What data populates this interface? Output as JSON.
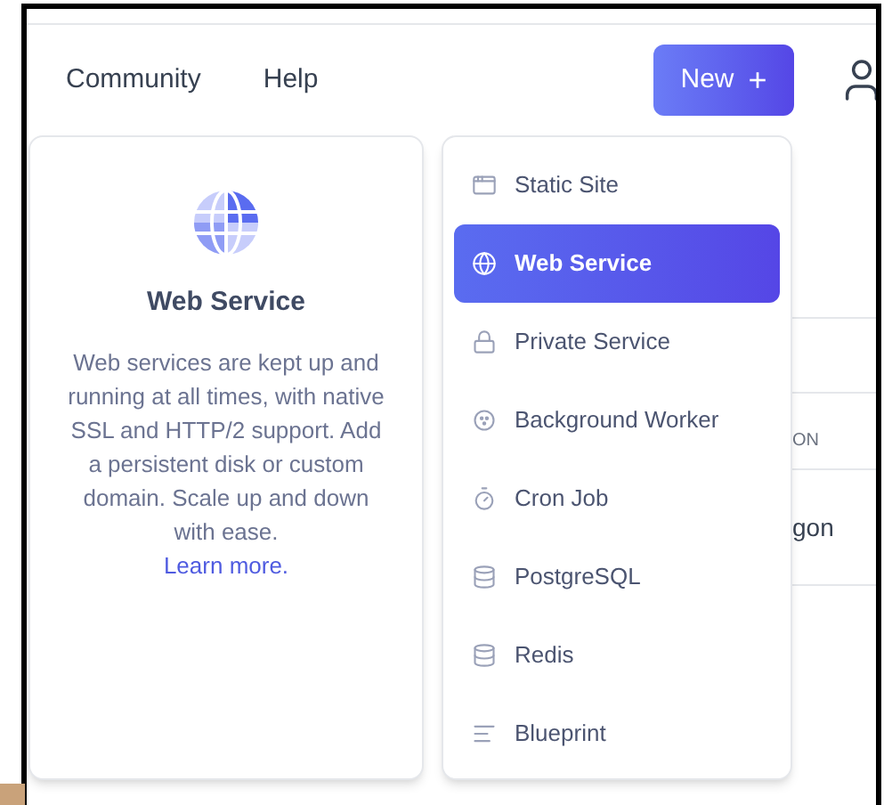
{
  "nav": [
    {
      "label": "Community"
    },
    {
      "label": "Help"
    }
  ],
  "new_button": {
    "label": "New",
    "symbol": "+"
  },
  "detail": {
    "title": "Web Service",
    "description": "Web services are kept up and running at all times, with native SSL and HTTP/2 support. Add a persistent disk or custom domain. Scale up and down with ease.",
    "link": "Learn more."
  },
  "menu": [
    {
      "label": "Static Site",
      "kind": "static",
      "selected": false
    },
    {
      "label": "Web Service",
      "kind": "web",
      "selected": true
    },
    {
      "label": "Private Service",
      "kind": "private",
      "selected": false
    },
    {
      "label": "Background Worker",
      "kind": "worker",
      "selected": false
    },
    {
      "label": "Cron Job",
      "kind": "cron",
      "selected": false
    },
    {
      "label": "PostgreSQL",
      "kind": "database",
      "selected": false
    },
    {
      "label": "Redis",
      "kind": "database",
      "selected": false
    },
    {
      "label": "Blueprint",
      "kind": "blueprint",
      "selected": false
    }
  ],
  "background_table": {
    "column_header": "ON",
    "cell": "gon"
  }
}
